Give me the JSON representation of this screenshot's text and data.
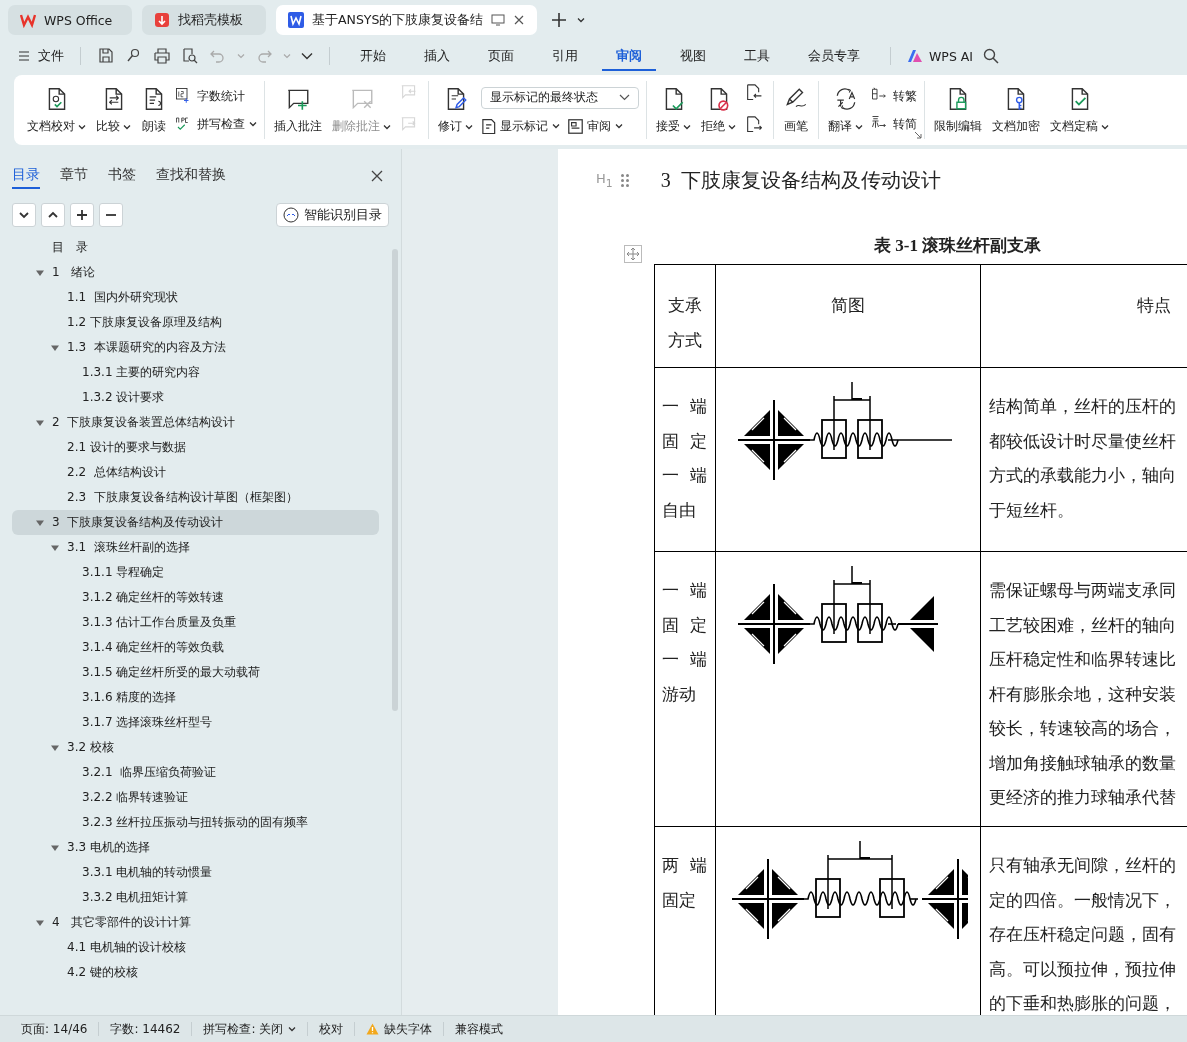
{
  "browser_tabs": [
    {
      "label": "WPS Office",
      "selected": false
    },
    {
      "label": "找稻壳模板",
      "selected": false
    },
    {
      "label": "基于ANSYS的下肢康复设备结",
      "selected": true
    }
  ],
  "menu": {
    "file": "文件",
    "tabs": [
      {
        "label": "开始",
        "selected": false
      },
      {
        "label": "插入",
        "selected": false
      },
      {
        "label": "页面",
        "selected": false
      },
      {
        "label": "引用",
        "selected": false
      },
      {
        "label": "审阅",
        "selected": true
      },
      {
        "label": "视图",
        "selected": false
      },
      {
        "label": "工具",
        "selected": false
      },
      {
        "label": "会员专享",
        "selected": false
      }
    ],
    "ai": "WPS AI"
  },
  "ribbon": {
    "groups": [
      {
        "items": [
          {
            "kind": "large",
            "label": "文档校对",
            "dropdown": true,
            "disabled": false
          },
          {
            "kind": "large",
            "label": "比较",
            "dropdown": true,
            "disabled": false
          },
          {
            "kind": "large",
            "label": "朗读",
            "dropdown": false,
            "disabled": false
          },
          {
            "kind": "stack",
            "rows": [
              [
                {
                  "kind": "small",
                  "label": "字数统计",
                  "dropdown": false,
                  "disabled": false
                }
              ],
              [
                {
                  "kind": "small",
                  "label": "拼写检查",
                  "dropdown": true,
                  "disabled": false
                }
              ]
            ]
          }
        ]
      },
      {
        "items": [
          {
            "kind": "large",
            "label": "插入批注",
            "dropdown": false,
            "disabled": false
          },
          {
            "kind": "large",
            "label": "删除批注",
            "dropdown": true,
            "disabled": true
          },
          {
            "kind": "stack",
            "rows": [
              [
                {
                  "kind": "icon",
                  "disabled": true
                }
              ],
              [
                {
                  "kind": "icon",
                  "disabled": true
                }
              ]
            ]
          }
        ]
      },
      {
        "items": [
          {
            "kind": "large",
            "label": "修订",
            "dropdown": true,
            "disabled": false
          },
          {
            "kind": "stack",
            "rows": [
              [
                {
                  "kind": "select",
                  "value": "显示标记的最终状态"
                }
              ],
              [
                {
                  "kind": "small",
                  "label": "显示标记",
                  "dropdown": true,
                  "disabled": false
                },
                {
                  "kind": "small",
                  "label": "审阅",
                  "dropdown": true,
                  "disabled": false
                }
              ]
            ]
          }
        ]
      },
      {
        "items": [
          {
            "kind": "large",
            "label": "接受",
            "dropdown": true,
            "disabled": false
          },
          {
            "kind": "large",
            "label": "拒绝",
            "dropdown": true,
            "disabled": false
          },
          {
            "kind": "stack",
            "rows": [
              [
                {
                  "kind": "icon",
                  "disabled": false
                }
              ],
              [
                {
                  "kind": "icon",
                  "disabled": false
                }
              ]
            ]
          }
        ]
      },
      {
        "items": [
          {
            "kind": "large",
            "label": "画笔",
            "dropdown": false,
            "disabled": false
          }
        ]
      },
      {
        "launcher": true,
        "items": [
          {
            "kind": "large",
            "label": "翻译",
            "dropdown": true,
            "disabled": false
          },
          {
            "kind": "stack",
            "rows": [
              [
                {
                  "kind": "small",
                  "label": "转繁",
                  "dropdown": false,
                  "disabled": false
                }
              ],
              [
                {
                  "kind": "small",
                  "label": "转简",
                  "dropdown": false,
                  "disabled": false
                }
              ]
            ]
          }
        ]
      },
      {
        "items": [
          {
            "kind": "large",
            "label": "限制编辑",
            "dropdown": false,
            "disabled": false
          },
          {
            "kind": "large",
            "label": "文档加密",
            "dropdown": false,
            "disabled": false
          },
          {
            "kind": "large",
            "label": "文档定稿",
            "dropdown": true,
            "disabled": false
          }
        ]
      }
    ]
  },
  "sidebar": {
    "tabs": [
      {
        "label": "目录",
        "selected": true
      },
      {
        "label": "章节",
        "selected": false
      },
      {
        "label": "书签",
        "selected": false
      },
      {
        "label": "查找和替换",
        "selected": false
      }
    ],
    "smart_toc_button": "智能识别目录",
    "toc": [
      {
        "label": "目　录",
        "selected": false
      },
      {
        "label": "1   绪论",
        "selected": false,
        "expanded": true,
        "children": [
          {
            "label": "1.1  国内外研究现状",
            "selected": false
          },
          {
            "label": "1.2 下肢康复设备原理及结构",
            "selected": false
          },
          {
            "label": "1.3  本课题研究的内容及方法",
            "selected": false,
            "expanded": true,
            "children": [
              {
                "label": "1.3.1 主要的研究内容",
                "selected": false
              },
              {
                "label": "1.3.2 设计要求",
                "selected": false
              }
            ]
          }
        ]
      },
      {
        "label": "2  下肢康复设备装置总体结构设计",
        "selected": false,
        "expanded": true,
        "children": [
          {
            "label": "2.1 设计的要求与数据",
            "selected": false
          },
          {
            "label": "2.2  总体结构设计",
            "selected": false
          },
          {
            "label": "2.3  下肢康复设备结构设计草图（框架图）",
            "selected": false
          }
        ]
      },
      {
        "label": "3  下肢康复设备结构及传动设计",
        "selected": true,
        "expanded": true,
        "children": [
          {
            "label": "3.1  滚珠丝杆副的选择",
            "selected": false,
            "expanded": true,
            "children": [
              {
                "label": "3.1.1 导程确定",
                "selected": false
              },
              {
                "label": "3.1.2 确定丝杆的等效转速",
                "selected": false
              },
              {
                "label": "3.1.3 估计工作台质量及负重",
                "selected": false
              },
              {
                "label": "3.1.4 确定丝杆的等效负载",
                "selected": false
              },
              {
                "label": "3.1.5 确定丝杆所受的最大动载荷",
                "selected": false
              },
              {
                "label": "3.1.6 精度的选择",
                "selected": false
              },
              {
                "label": "3.1.7 选择滚珠丝杆型号",
                "selected": false
              }
            ]
          },
          {
            "label": "3.2 校核",
            "selected": false,
            "expanded": true,
            "children": [
              {
                "label": "3.2.1  临界压缩负荷验证",
                "selected": false
              },
              {
                "label": "3.2.2 临界转速验证",
                "selected": false
              },
              {
                "label": "3.2.3 丝杆拉压振动与扭转振动的固有频率",
                "selected": false
              }
            ]
          },
          {
            "label": "3.3 电机的选择",
            "selected": false,
            "expanded": true,
            "children": [
              {
                "label": "3.3.1 电机轴的转动惯量",
                "selected": false
              },
              {
                "label": "3.3.2 电机扭矩计算",
                "selected": false
              }
            ]
          }
        ]
      },
      {
        "label": "4   其它零部件的设计计算",
        "selected": false,
        "expanded": true,
        "children": [
          {
            "label": "4.1 电机轴的设计校核",
            "selected": false
          },
          {
            "label": "4.2 键的校核",
            "selected": false
          }
        ]
      }
    ]
  },
  "document": {
    "heading_marker": "H$_{1}$",
    "heading": "3  下肢康复设备结构及传动设计",
    "table_caption": "表 3-1 滚珠丝杆副支承",
    "columns": [
      {
        "lines": [
          "支承",
          "方式"
        ]
      },
      {
        "lines": [
          "简图"
        ]
      },
      {
        "lines": [
          "特点"
        ]
      }
    ],
    "rows": [
      {
        "kind": "fixed_free",
        "support": [
          "一 端",
          "固 定",
          "一 端",
          "自由"
        ],
        "features": [
          "结构简单，丝杆的压杆的",
          "都较低设计时尽量使丝杆",
          "方式的承载能力小，轴向",
          "于短丝杆。"
        ]
      },
      {
        "kind": "fixed_floating",
        "support": [
          "一 端",
          "固 定",
          "一 端",
          "游动"
        ],
        "features": [
          "需保证螺母与两端支承同",
          "工艺较困难，丝杆的轴向",
          "压杆稳定性和临界转速比",
          "杆有膨胀余地，这种安装",
          "较长，转速较高的场合，",
          "增加角接触球轴承的数量",
          "更经济的推力球轴承代替"
        ]
      },
      {
        "kind": "fixed_fixed",
        "support": [
          "两 端",
          "固定"
        ],
        "features": [
          "只有轴承无间隙，丝杆的",
          "定的四倍。一般情况下，",
          "存在压杆稳定问题，固有",
          "高。可以预拉伸，预拉伸",
          "的下垂和热膨胀的问题，"
        ]
      }
    ]
  },
  "status_bar": [
    {
      "kind": "text",
      "text": "页面: 14/46"
    },
    {
      "kind": "text",
      "text": "字数: 14462"
    },
    {
      "kind": "dropdown",
      "text": "拼写检查: 关闭"
    },
    {
      "kind": "text",
      "text": "校对"
    },
    {
      "kind": "warning",
      "text": "缺失字体"
    },
    {
      "kind": "text",
      "text": "兼容模式"
    }
  ]
}
